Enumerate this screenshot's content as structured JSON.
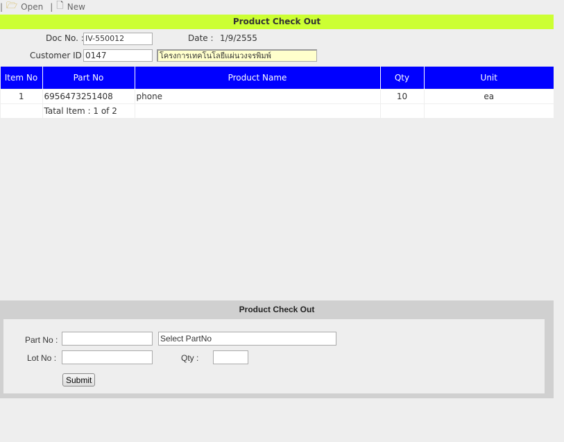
{
  "toolbar": {
    "open": "Open",
    "new": "New",
    "sep": "|"
  },
  "header": {
    "title": "Product Check Out"
  },
  "doc": {
    "doc_label": "Doc No. :",
    "doc_value": "IV-550012",
    "date_label": "Date :",
    "date_value": "1/9/2555",
    "cust_label": "Customer ID :",
    "cust_value": "0147",
    "cust_name": "โครงการเทคโนโลยีแผ่นวงจรพิมพ์"
  },
  "table": {
    "headers": [
      "Item No",
      "Part No",
      "Product Name",
      "Qty",
      "Unit"
    ],
    "rows": [
      [
        "1",
        "6956473251408",
        "phone",
        "10",
        "ea"
      ]
    ],
    "total": "Tatal Item : 1 of 2"
  },
  "form": {
    "title": "Product Check Out",
    "part_label": "Part No :",
    "part_value": "",
    "select_value": "Select PartNo",
    "lot_label": "Lot No :",
    "lot_value": "",
    "qty_label": "Qty :",
    "qty_value": "",
    "submit": "Submit"
  }
}
